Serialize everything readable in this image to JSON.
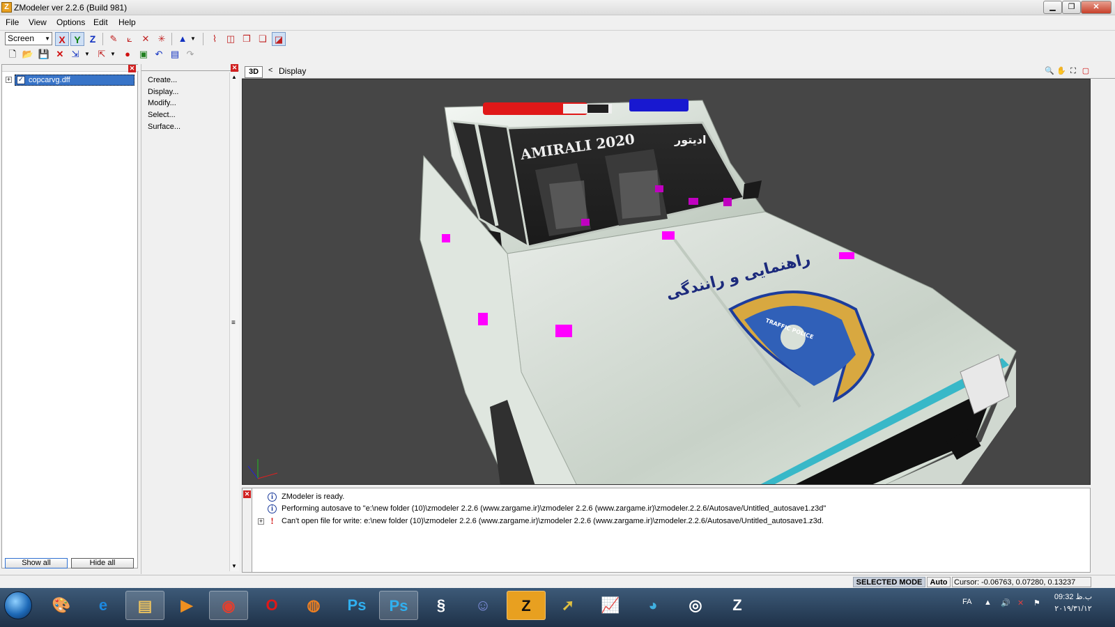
{
  "window": {
    "title": "ZModeler ver 2.2.6 (Build 981)",
    "icon_letter": "Z",
    "min": "0",
    "max": "1",
    "close": "r"
  },
  "menu": [
    "File",
    "View",
    "Options",
    "Edit",
    "Help"
  ],
  "toolbar": {
    "screen_select": "Screen",
    "axis_x": "X",
    "axis_y": "Y",
    "axis_z": "Z"
  },
  "tree": {
    "item_label": "copcarvg.dff",
    "checked": true,
    "show_all": "Show all",
    "hide_all": "Hide all"
  },
  "commands": [
    "Create...",
    "Display...",
    "Modify...",
    "Select...",
    "Surface..."
  ],
  "viewport": {
    "mode_label": "3D",
    "back": "<",
    "current": "Display",
    "background": "#464646",
    "scene_text": {
      "windshield_latin": "AMIRALI 2020",
      "windshield_farsi": "ادیتور",
      "hood_farsi": "راهنمایی و رانندگی",
      "badge": "TRAFFIC POLICE"
    }
  },
  "log": [
    {
      "type": "info",
      "text": "ZModeler is ready."
    },
    {
      "type": "info",
      "text": "Performing autosave to \"e:\\new folder (10)\\zmodeler 2.2.6 (www.zargame.ir)\\zmodeler 2.2.6 (www.zargame.ir)\\zmodeler.2.2.6/Autosave/Untitled_autosave1.z3d\""
    },
    {
      "type": "error",
      "text": "Can't open file for write: e:\\new folder (10)\\zmodeler 2.2.6 (www.zargame.ir)\\zmodeler 2.2.6 (www.zargame.ir)\\zmodeler.2.2.6/Autosave/Untitled_autosave1.z3d."
    }
  ],
  "status": {
    "mode": "SELECTED MODE",
    "auto": "Auto",
    "cursor": "Cursor: -0.06763, 0.07280, 0.13237"
  },
  "taskbar": {
    "lang": "FA",
    "time": "09:32 ب.ظ",
    "date": "۲۰۱۹/۳۱/۱۲",
    "icons": [
      "paint-icon",
      "ie-icon",
      "explorer-icon",
      "media-player-icon",
      "chrome-icon",
      "opera-icon",
      "firefox-icon",
      "photoshop-icon",
      "photoshop-icon-2",
      "script-icon",
      "discord-icon",
      "zmodeler-icon",
      "app-arrow-icon",
      "app-chart-icon",
      "app-globe-icon",
      "obs-icon",
      "zmodeler-dark-icon"
    ],
    "ps_label": "Ps",
    "z_label": "Z"
  },
  "colors": {
    "selection": "#3874c8",
    "mode_badge": "#c8d0dc",
    "vertex_marker": "#ff00ff"
  }
}
